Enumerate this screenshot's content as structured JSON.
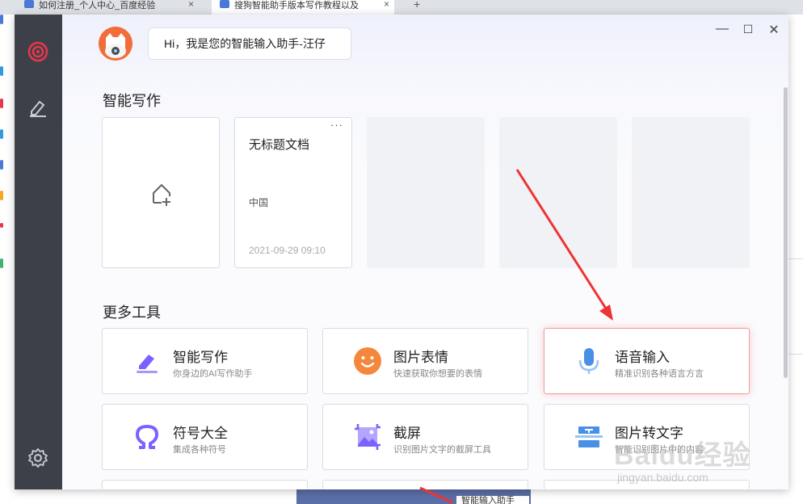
{
  "browser": {
    "tabs": [
      {
        "label": "如何注册_个人中心_百度经验"
      },
      {
        "label": "搜狗智能助手版本写作教程以及"
      }
    ],
    "new_tab": "+",
    "close_symbol": "×"
  },
  "window": {
    "greeting": "Hi，我是您的智能输入助手-汪仔",
    "controls": {
      "minimize": "—",
      "maximize": "☐",
      "close": "✕"
    }
  },
  "sidebar": {
    "items": [
      {
        "icon": "target-icon"
      },
      {
        "icon": "pen-icon"
      },
      {
        "icon": "gear-icon"
      }
    ]
  },
  "writing": {
    "section_title": "智能写作",
    "new_doc_icon": "new-document-icon",
    "docs": [
      {
        "title": "无标题文档",
        "location": "中国",
        "date": "2021-09-29 09:10",
        "menu": "···"
      }
    ]
  },
  "tools": {
    "section_title": "更多工具",
    "items": [
      {
        "name": "智能写作",
        "desc": "你身边的AI写作助手",
        "icon": "ai-writing-icon"
      },
      {
        "name": "图片表情",
        "desc": "快速获取你想要的表情",
        "icon": "emoji-icon"
      },
      {
        "name": "语音输入",
        "desc": "精准识别各种语言方言",
        "icon": "microphone-icon"
      },
      {
        "name": "符号大全",
        "desc": "集成各种符号",
        "icon": "omega-icon"
      },
      {
        "name": "截屏",
        "desc": "识别图片文字的截屏工具",
        "icon": "screenshot-icon"
      },
      {
        "name": "图片转文字",
        "desc": "智能识别图片中的内容",
        "icon": "image-to-text-icon"
      }
    ]
  },
  "bottom_tip": "智能输入助手",
  "watermark": {
    "logo": "Baidu经验",
    "url": "jingyan.baidu.com"
  },
  "colors": {
    "sidebar": "#3e4049",
    "accent_red": "#e8364a",
    "highlight_border": "#f19b9b",
    "tool_purple": "#7b61ff",
    "tool_orange": "#f5873d",
    "tool_blue": "#4a8fe6"
  }
}
